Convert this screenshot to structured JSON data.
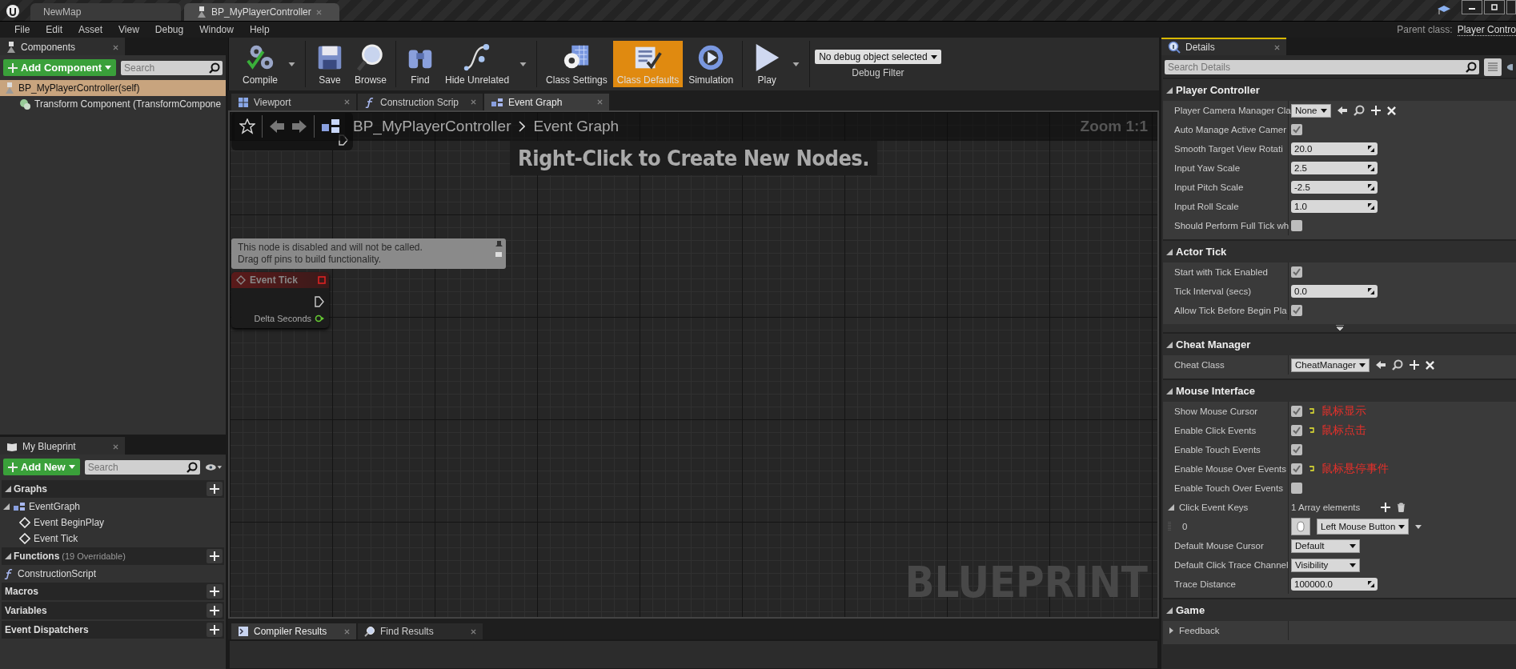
{
  "title_bar": {
    "tabs": [
      {
        "label": "NewMap",
        "selected": false
      },
      {
        "label": "BP_MyPlayerController",
        "selected": true
      }
    ]
  },
  "menu_bar": {
    "items": [
      "File",
      "Edit",
      "Asset",
      "View",
      "Debug",
      "Window",
      "Help"
    ],
    "parent_class_label": "Parent class:",
    "parent_class": "Player Contro"
  },
  "components": {
    "tab": "Components",
    "add_button": "Add Component",
    "search_placeholder": "Search",
    "tree": [
      {
        "label": "BP_MyPlayerController(self)",
        "selected": true,
        "children": [
          {
            "label": "Transform Component (TransformCompone",
            "selected": false
          }
        ]
      }
    ]
  },
  "toolbar": {
    "groups": [
      [
        {
          "kind": "compile",
          "label": "Compile",
          "selected": false,
          "menu": true
        }
      ],
      [
        {
          "kind": "save",
          "label": "Save",
          "selected": false,
          "menu": false
        },
        {
          "kind": "browse",
          "label": "Browse",
          "selected": false,
          "menu": false
        }
      ],
      [
        {
          "kind": "find",
          "label": "Find",
          "selected": false,
          "menu": false
        },
        {
          "kind": "hide",
          "label": "Hide Unrelated",
          "selected": false,
          "menu": true
        }
      ],
      [
        {
          "kind": "settings",
          "label": "Class Settings",
          "selected": false,
          "menu": false
        },
        {
          "kind": "defaults",
          "label": "Class Defaults",
          "selected": true,
          "menu": false
        },
        {
          "kind": "simulation",
          "label": "Simulation",
          "selected": false,
          "menu": false
        }
      ],
      [
        {
          "kind": "play",
          "label": "Play",
          "selected": false,
          "menu": true
        }
      ]
    ],
    "debug_filter": {
      "value": "No debug object selected",
      "label": "Debug Filter"
    }
  },
  "graph_tabs": [
    {
      "kind": "viewport",
      "label": "Viewport",
      "selected": false
    },
    {
      "kind": "function",
      "label": "Construction Scrip",
      "selected": false
    },
    {
      "kind": "graph",
      "label": "Event Graph",
      "selected": true
    }
  ],
  "graph": {
    "breadcrumb": [
      "BP_MyPlayerController",
      "Event Graph"
    ],
    "zoom": "Zoom 1:1",
    "hint": "Right-Click to Create New Nodes.",
    "watermark": "BLUEPRINT",
    "comment": "This node is disabled and will not be called.\nDrag off pins to build functionality.",
    "node": {
      "title": "Event Tick",
      "pin": "Delta Seconds"
    }
  },
  "bottom_tabs": [
    {
      "kind": "compiler",
      "label": "Compiler Results",
      "selected": true
    },
    {
      "kind": "search",
      "label": "Find Results",
      "selected": false
    }
  ],
  "my_blueprint": {
    "tab": "My Blueprint",
    "add_button": "Add New",
    "search_placeholder": "Search",
    "sections": [
      {
        "title": "Graphs",
        "items": [
          {
            "kind": "graph",
            "label": "EventGraph",
            "expanded": true,
            "children": [
              {
                "kind": "event",
                "label": "Event BeginPlay"
              },
              {
                "kind": "event",
                "label": "Event Tick"
              }
            ]
          }
        ]
      },
      {
        "title": "Functions",
        "note": "(19 Overridable)",
        "items": [
          {
            "kind": "function",
            "label": "ConstructionScript"
          }
        ]
      },
      {
        "title": "Macros"
      },
      {
        "title": "Variables"
      },
      {
        "title": "Event Dispatchers"
      }
    ]
  },
  "details": {
    "tab": "Details",
    "search_placeholder": "Search Details",
    "sections": [
      {
        "title": "Player Controller",
        "rows": [
          {
            "kind": "class",
            "label": "Player Camera Manager Cla",
            "value": "None"
          },
          {
            "kind": "check",
            "label": "Auto Manage Active Camer",
            "checked": true
          },
          {
            "kind": "number",
            "label": "Smooth Target View Rotati",
            "value": "20.0"
          },
          {
            "kind": "number",
            "label": "Input Yaw Scale",
            "value": "2.5"
          },
          {
            "kind": "number",
            "label": "Input Pitch Scale",
            "value": "-2.5"
          },
          {
            "kind": "number",
            "label": "Input Roll Scale",
            "value": "1.0"
          },
          {
            "kind": "check",
            "label": "Should Perform Full Tick wh",
            "checked": false
          }
        ]
      },
      {
        "title": "Actor Tick",
        "advanced_toggle": true,
        "rows": [
          {
            "kind": "check",
            "label": "Start with Tick Enabled",
            "checked": true
          },
          {
            "kind": "number",
            "label": "Tick Interval (secs)",
            "value": "0.0"
          },
          {
            "kind": "check",
            "label": "Allow Tick Before Begin Pla",
            "checked": true
          }
        ]
      },
      {
        "title": "Cheat Manager",
        "rows": [
          {
            "kind": "class",
            "label": "Cheat Class",
            "value": "CheatManager"
          }
        ]
      },
      {
        "title": "Mouse Interface",
        "rows": [
          {
            "kind": "check",
            "label": "Show Mouse Cursor",
            "checked": true,
            "reset": true,
            "note": "鼠标显示"
          },
          {
            "kind": "check",
            "label": "Enable Click Events",
            "checked": true,
            "reset": true,
            "note": "鼠标点击"
          },
          {
            "kind": "check",
            "label": "Enable Touch Events",
            "checked": true,
            "reset": false
          },
          {
            "kind": "check",
            "label": "Enable Mouse Over Events",
            "checked": true,
            "reset": true,
            "note": "鼠标悬停事件"
          },
          {
            "kind": "check",
            "label": "Enable Touch Over Events",
            "checked": false,
            "reset": false
          },
          {
            "kind": "array",
            "label": "Click Event Keys",
            "value": "1 Array elements",
            "expanded": true
          },
          {
            "kind": "key",
            "label": "0",
            "value": "Left Mouse Button"
          },
          {
            "kind": "dropdown",
            "label": "Default Mouse Cursor",
            "value": "Default"
          },
          {
            "kind": "dropdown",
            "label": "Default Click Trace Channel",
            "value": "Visibility"
          },
          {
            "kind": "number",
            "label": "Trace Distance",
            "value": "100000.0"
          }
        ]
      },
      {
        "title": "Game",
        "rows": [
          {
            "kind": "group",
            "label": "Feedback",
            "expanded": false
          }
        ]
      }
    ]
  }
}
